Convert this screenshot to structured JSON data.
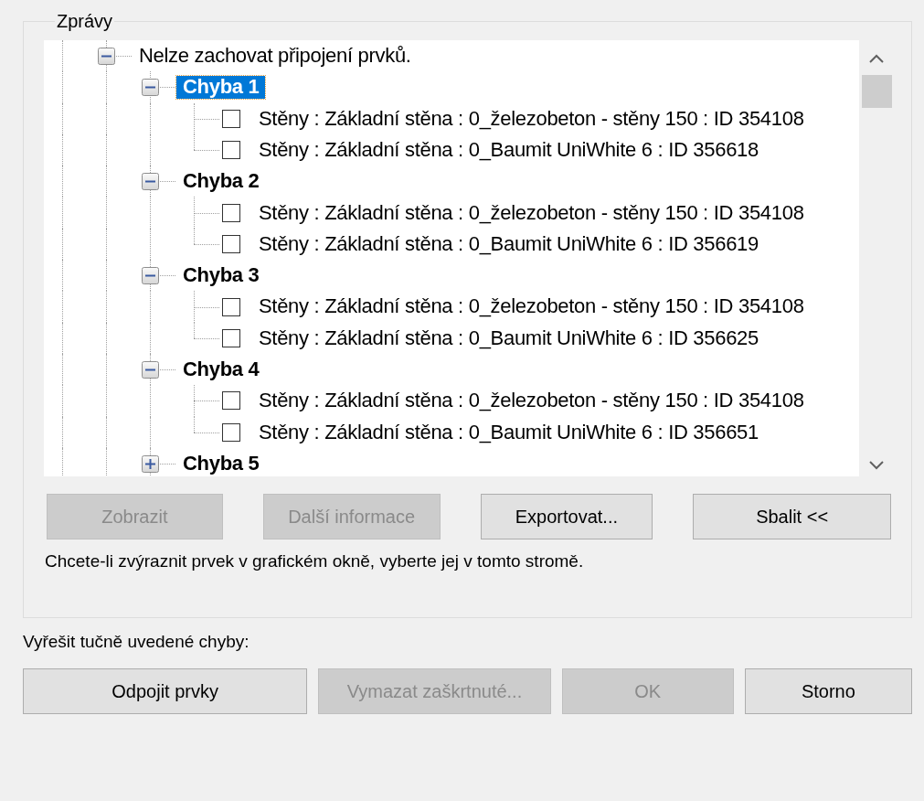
{
  "group_title": "Zprávy",
  "tree": {
    "items": [
      {
        "kind": "group",
        "label": "Nelze zachovat připojení prvků.",
        "expanded": true,
        "selected": false,
        "children": [
          {
            "kind": "error",
            "label": "Chyba 1",
            "expanded": true,
            "selected": true,
            "children": [
              {
                "kind": "element",
                "label": "Stěny : Základní stěna : 0_železobeton - stěny 150 : ID 354108",
                "checked": false,
                "selected": false
              },
              {
                "kind": "element",
                "label": "Stěny : Základní stěna : 0_Baumit UniWhite 6 : ID 356618",
                "checked": false,
                "selected": false
              }
            ]
          },
          {
            "kind": "error",
            "label": "Chyba 2",
            "expanded": true,
            "selected": false,
            "children": [
              {
                "kind": "element",
                "label": "Stěny : Základní stěna : 0_železobeton - stěny 150 : ID 354108",
                "checked": false,
                "selected": false
              },
              {
                "kind": "element",
                "label": "Stěny : Základní stěna : 0_Baumit UniWhite 6 : ID 356619",
                "checked": false,
                "selected": false
              }
            ]
          },
          {
            "kind": "error",
            "label": "Chyba 3",
            "expanded": true,
            "selected": false,
            "children": [
              {
                "kind": "element",
                "label": "Stěny : Základní stěna : 0_železobeton - stěny 150 : ID 354108",
                "checked": false,
                "selected": false
              },
              {
                "kind": "element",
                "label": "Stěny : Základní stěna : 0_Baumit UniWhite 6 : ID 356625",
                "checked": false,
                "selected": false
              }
            ]
          },
          {
            "kind": "error",
            "label": "Chyba 4",
            "expanded": true,
            "selected": false,
            "children": [
              {
                "kind": "element",
                "label": "Stěny : Základní stěna : 0_železobeton - stěny 150 : ID 354108",
                "checked": false,
                "selected": false
              },
              {
                "kind": "element",
                "label": "Stěny : Základní stěna : 0_Baumit UniWhite 6 : ID 356651",
                "checked": false,
                "selected": false
              }
            ]
          },
          {
            "kind": "error",
            "label": "Chyba 5",
            "expanded": false,
            "selected": false
          }
        ]
      }
    ]
  },
  "tree_buttons": [
    {
      "label": "Zobrazit",
      "disabled": true
    },
    {
      "label": "Další informace",
      "disabled": true
    },
    {
      "label": "Exportovat...",
      "disabled": false
    },
    {
      "label": "Sbalit <<",
      "disabled": false
    }
  ],
  "hint": "Chcete-li zvýraznit prvek v grafickém okně, vyberte jej v tomto stromě.",
  "resolve_label": "Vyřešit tučně uvedené chyby:",
  "dialog_buttons": [
    {
      "label": "Odpojit prvky",
      "disabled": false
    },
    {
      "label": "Vymazat zaškrtnuté...",
      "disabled": true
    },
    {
      "label": "OK",
      "disabled": true
    },
    {
      "label": "Storno",
      "disabled": false
    }
  ]
}
